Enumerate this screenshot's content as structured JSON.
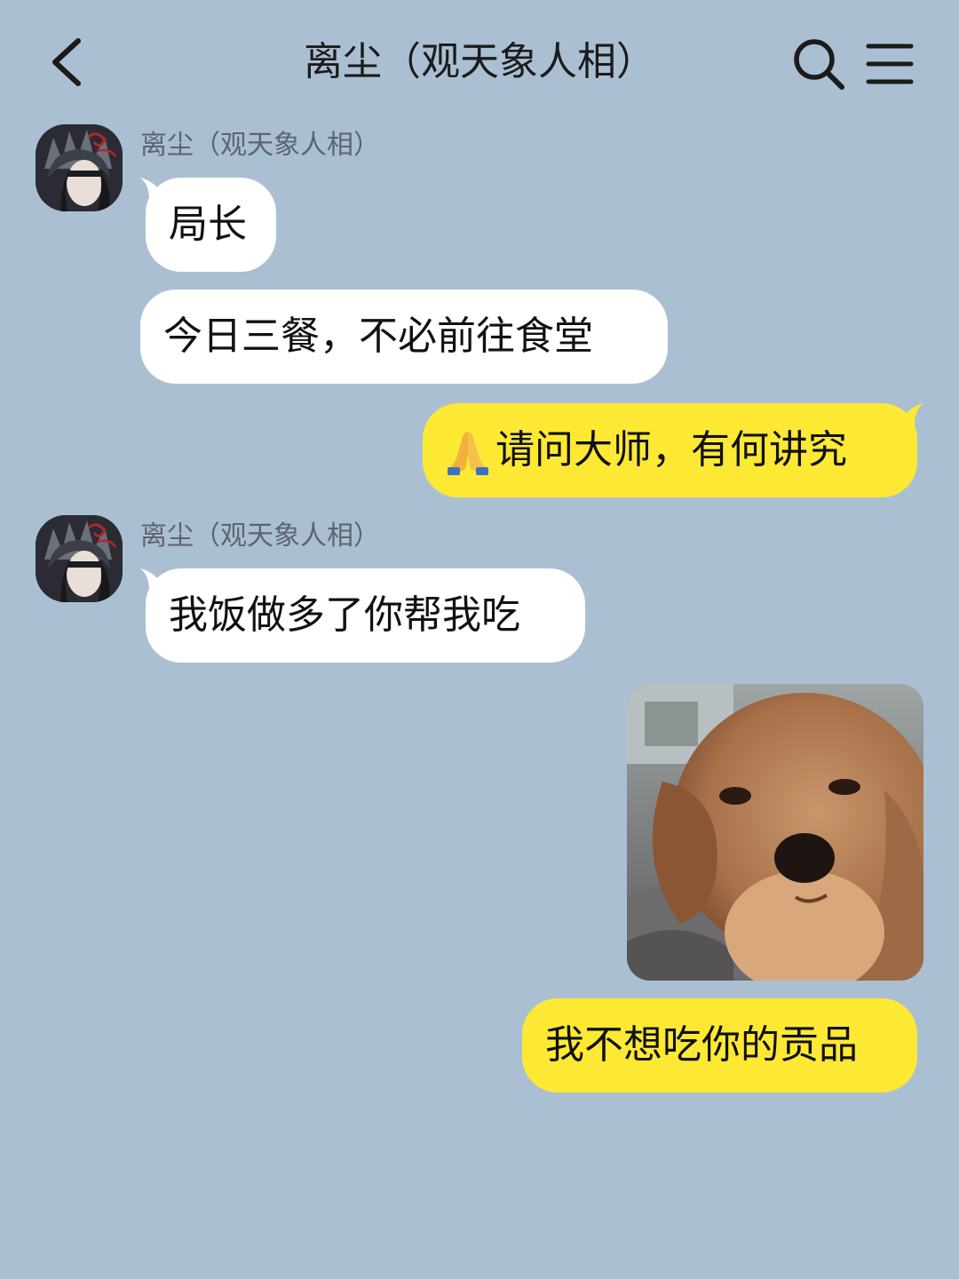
{
  "header": {
    "title": "离尘（观天象人相）",
    "back_icon": "chevron-left-icon",
    "search_icon": "search-icon",
    "menu_icon": "hamburger-menu-icon"
  },
  "messages": [
    {
      "direction": "in",
      "sender": "离尘（观天象人相）",
      "text": "局长"
    },
    {
      "direction": "in",
      "text": "今日三餐，不必前往食堂"
    },
    {
      "direction": "out",
      "emoji": "folded-hands",
      "text": "请问大师，有何讲究"
    },
    {
      "direction": "in",
      "sender": "离尘（观天象人相）",
      "text": "我饭做多了你帮我吃"
    },
    {
      "direction": "out",
      "type": "image",
      "image_subject": "puppy-meme"
    },
    {
      "direction": "out",
      "text": "我不想吃你的贡品"
    }
  ],
  "colors": {
    "background": "#abbfd2",
    "incoming_bubble": "#ffffff",
    "outgoing_bubble": "#fde934"
  }
}
